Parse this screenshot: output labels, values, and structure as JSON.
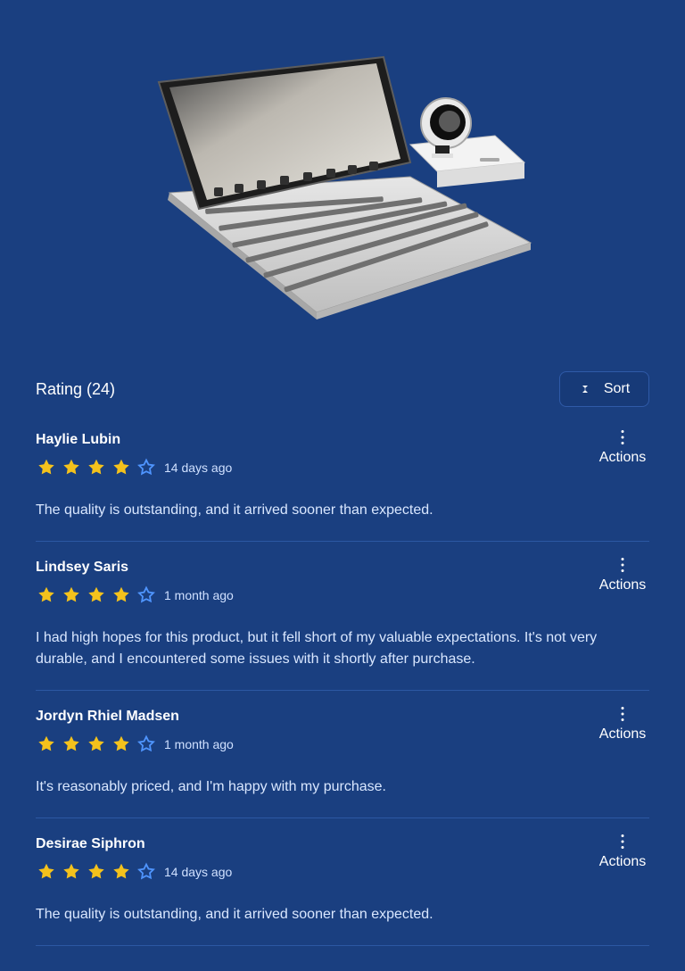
{
  "product": {
    "image_icon": "tablet-keyboard-product-image"
  },
  "header": {
    "title": "Rating (24)",
    "sort_label": "Sort"
  },
  "colors": {
    "background": "#1a3f80",
    "star_filled": "#f4c21c",
    "star_empty": "#4f95ff",
    "divider": "#2c58a3"
  },
  "reviews": [
    {
      "name": "Haylie Lubin",
      "rating": 4,
      "date": "14 days ago",
      "text": "The quality is outstanding, and it arrived sooner than expected.",
      "actions_label": "Actions"
    },
    {
      "name": "Lindsey Saris",
      "rating": 4,
      "date": "1 month ago",
      "text": "I had high hopes for this product, but it fell short of my valuable expectations. It's not very durable, and I encountered some issues with it shortly after purchase.",
      "actions_label": "Actions"
    },
    {
      "name": "Jordyn Rhiel Madsen",
      "rating": 4,
      "date": "1 month ago",
      "text": "It's reasonably priced, and I'm happy with my purchase.",
      "actions_label": "Actions"
    },
    {
      "name": "Desirae Siphron",
      "rating": 4,
      "date": "14 days ago",
      "text": "The quality is outstanding, and it arrived sooner than expected.",
      "actions_label": "Actions"
    }
  ]
}
